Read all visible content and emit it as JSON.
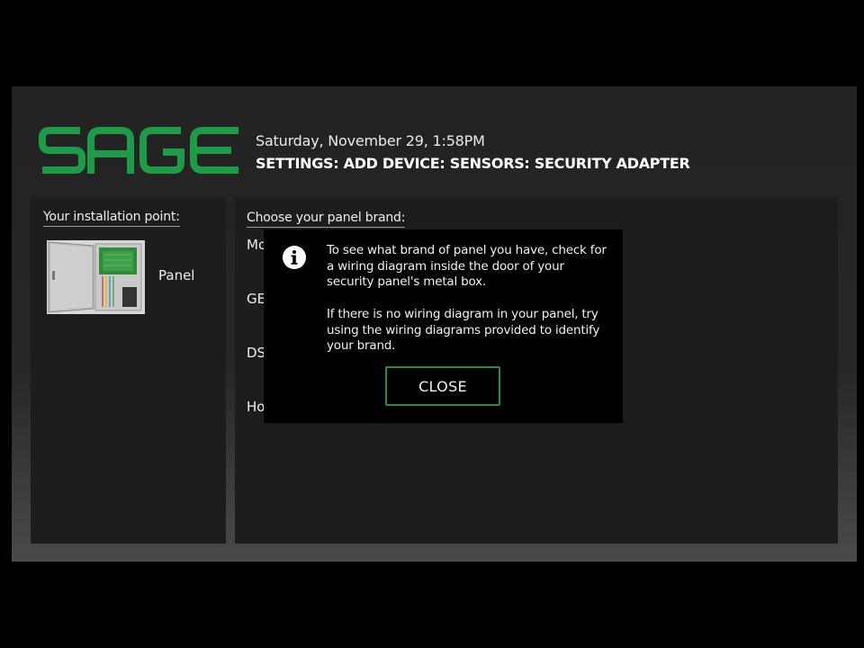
{
  "header": {
    "logo_text": "SAGE",
    "date_time": "Saturday, November 29, 1:58PM",
    "breadcrumb": "SETTINGS: ADD DEVICE: SENSORS: SECURITY ADAPTER"
  },
  "installation": {
    "title": "Your installation point:",
    "item_label": "Panel"
  },
  "brands": {
    "title": "Choose your panel brand:",
    "items": [
      "Mo",
      "GE",
      "DS",
      "Ho"
    ]
  },
  "modal": {
    "icon": "info-icon",
    "message_1": "To see what brand of panel you have, check for a wiring diagram inside the door of your security panel's metal box.",
    "message_2": "If there is no wiring diagram in your panel, try using the wiring diagrams provided to identify your brand.",
    "close_label": "CLOSE"
  },
  "colors": {
    "brand_green": "#1f9a48",
    "button_border": "#2e8b46",
    "modal_bg": "#000000",
    "panel_bg": "#1d1d1d"
  }
}
